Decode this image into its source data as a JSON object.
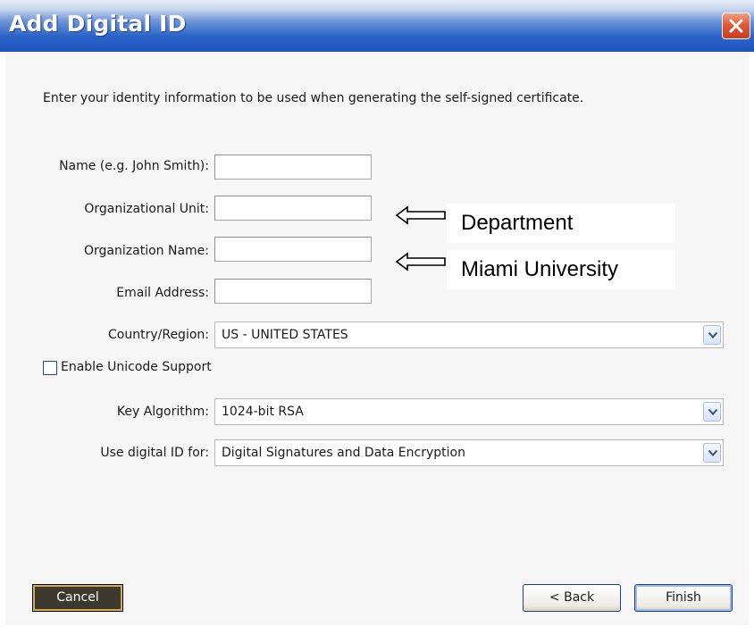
{
  "window": {
    "title": "Add Digital ID",
    "close_icon": "close-icon",
    "accent_color": "#2b64c8",
    "close_color": "#dd5a38"
  },
  "intro_text": "Enter your identity information to be used when generating the self-signed certificate.",
  "fields": {
    "name": {
      "label": "Name (e.g. John Smith):",
      "value": ""
    },
    "org_unit": {
      "label": "Organizational Unit:",
      "value": ""
    },
    "org_name": {
      "label": "Organization Name:",
      "value": ""
    },
    "email": {
      "label": "Email Address:",
      "value": ""
    }
  },
  "country": {
    "label": "Country/Region:",
    "value": "US - UNITED STATES"
  },
  "unicode": {
    "label": "Enable Unicode Support",
    "checked": false
  },
  "key_algorithm": {
    "label": "Key Algorithm:",
    "value": "1024-bit RSA"
  },
  "use_for": {
    "label": "Use digital ID for:",
    "value": "Digital Signatures and Data Encryption"
  },
  "annotations": {
    "department": "Department",
    "university": "Miami University"
  },
  "buttons": {
    "cancel": "Cancel",
    "back": "< Back",
    "finish": "Finish"
  }
}
